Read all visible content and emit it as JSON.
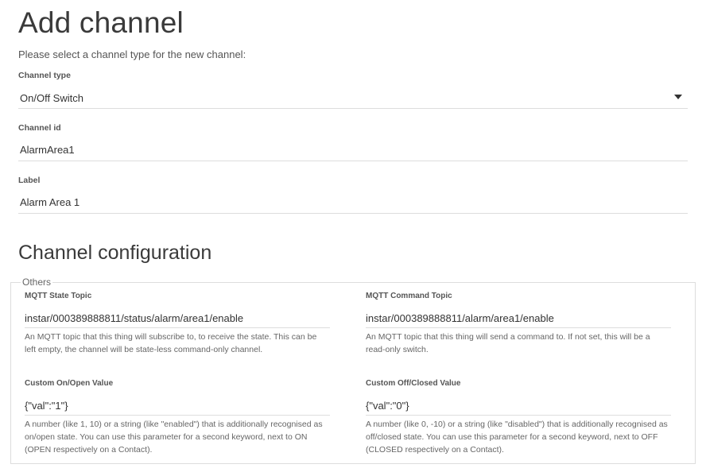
{
  "page": {
    "title": "Add channel",
    "intro": "Please select a channel type for the new channel:"
  },
  "channel_type": {
    "label": "Channel type",
    "selected": "On/Off Switch"
  },
  "channel_id": {
    "label": "Channel id",
    "value": "AlarmArea1"
  },
  "label_field": {
    "label": "Label",
    "value": "Alarm Area 1"
  },
  "configuration": {
    "title": "Channel configuration",
    "group": "Others",
    "state_topic": {
      "label": "MQTT State Topic",
      "value": "instar/000389888811/status/alarm/area1/enable",
      "help": "An MQTT topic that this thing will subscribe to, to receive the state. This can be left empty, the channel will be state-less command-only channel."
    },
    "command_topic": {
      "label": "MQTT Command Topic",
      "value": "instar/000389888811/alarm/area1/enable",
      "help": "An MQTT topic that this thing will send a command to. If not set, this will be a read-only switch."
    },
    "on_value": {
      "label": "Custom On/Open Value",
      "value": "{\"val\":\"1\"}",
      "help": "A number (like 1, 10) or a string (like \"enabled\") that is additionally recognised as on/open state. You can use this parameter for a second keyword, next to ON (OPEN respectively on a Contact)."
    },
    "off_value": {
      "label": "Custom Off/Closed Value",
      "value": "{\"val\":\"0\"}",
      "help": "A number (like 0, -10) or a string (like \"disabled\") that is additionally recognised as off/closed state. You can use this parameter for a second keyword, next to OFF (CLOSED respectively on a Contact)."
    }
  }
}
